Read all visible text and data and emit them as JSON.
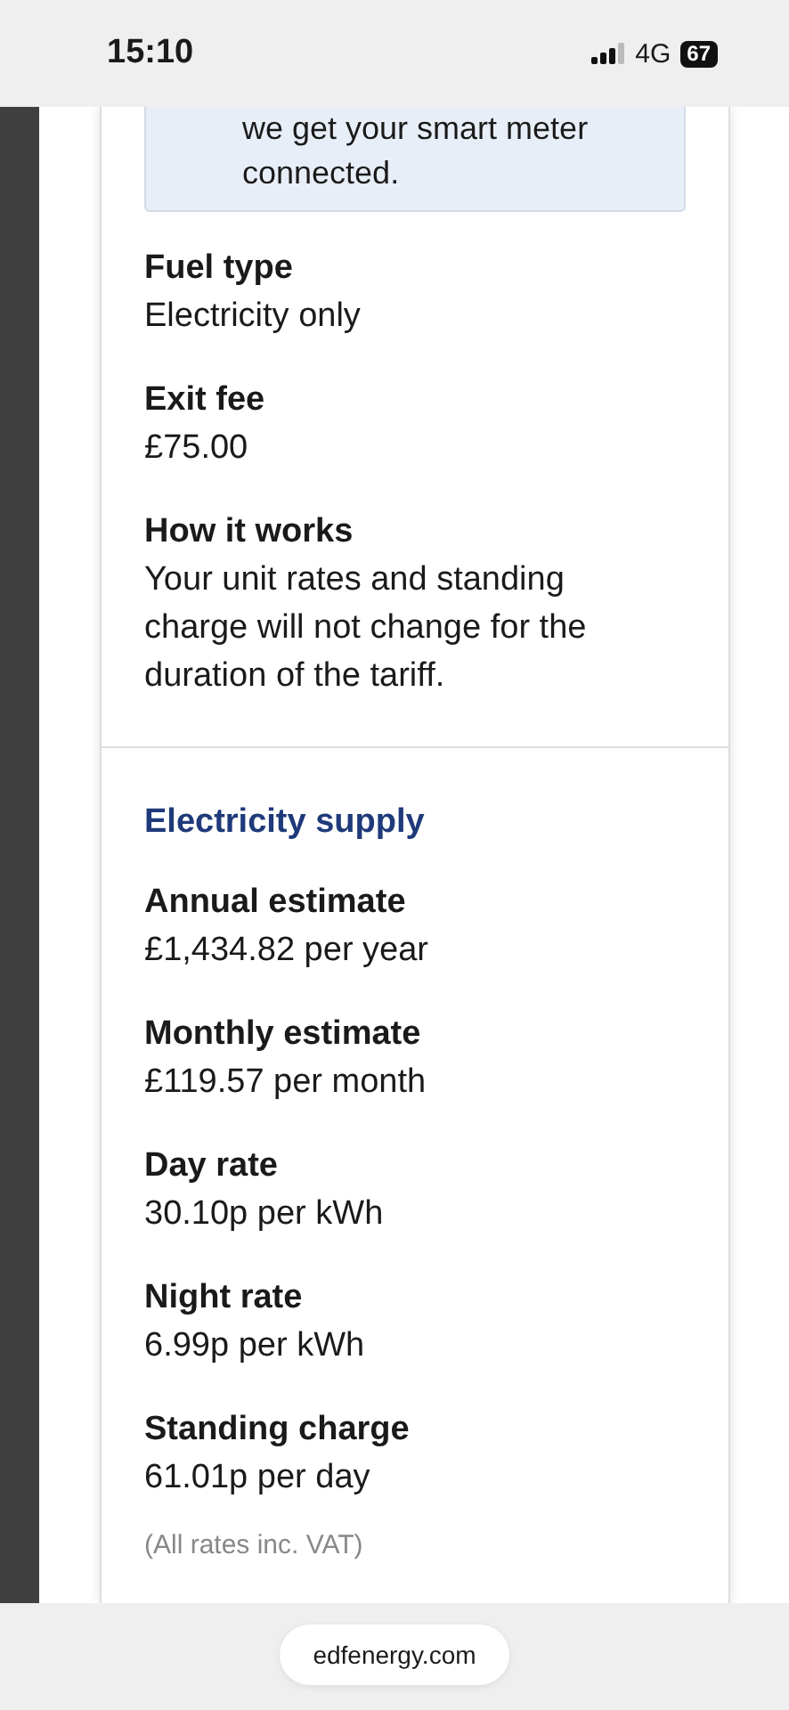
{
  "status_bar": {
    "time": "15:10",
    "network": "4G",
    "battery": "67"
  },
  "notice": {
    "lines": [
      "we get your smart meter",
      "connected."
    ]
  },
  "tariff_details": [
    {
      "label": "Fuel type",
      "value": "Electricity only"
    },
    {
      "label": "Exit fee",
      "value": "£75.00"
    },
    {
      "label": "How it works",
      "value": "Your unit rates and standing charge will not change for the duration of the tariff."
    }
  ],
  "electricity_supply": {
    "heading": "Electricity supply",
    "items": [
      {
        "label": "Annual estimate",
        "value": "£1,434.82 per year"
      },
      {
        "label": "Monthly estimate",
        "value": "£119.57 per month"
      },
      {
        "label": "Day rate",
        "value": "30.10p per kWh"
      },
      {
        "label": "Night rate",
        "value": "6.99p per kWh"
      },
      {
        "label": "Standing charge",
        "value": "61.01p per day"
      }
    ],
    "footnote": "(All rates inc. VAT)"
  },
  "browser": {
    "url": "edfenergy.com"
  }
}
